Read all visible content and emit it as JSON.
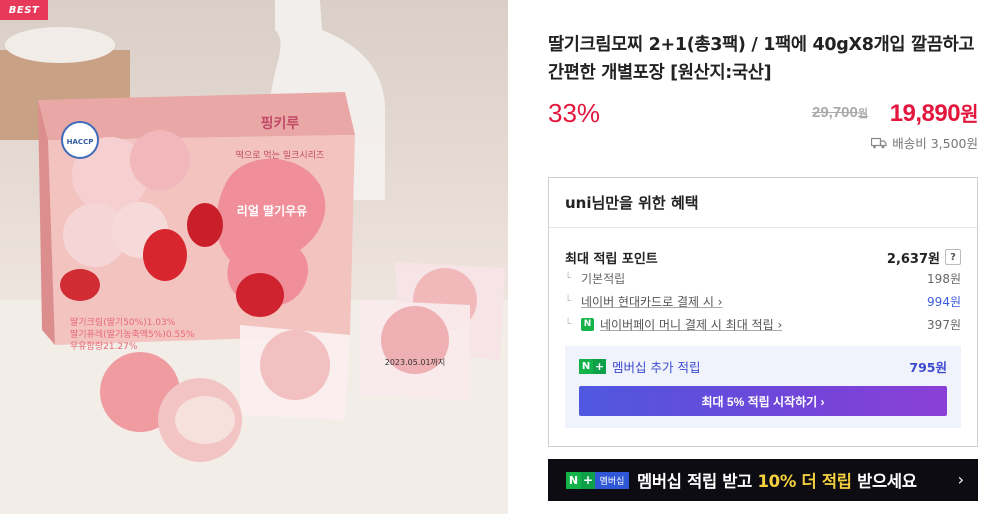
{
  "image": {
    "badge": "BEST",
    "box_brand": "핑키루",
    "box_tagline": "떡으로 먹는 밀크시리즈",
    "box_product": "리얼 딸기우유",
    "haccp": "HACCP",
    "ingredients": [
      "딸기크림(딸기50%)1.03%",
      "딸기퓨레(딸기농축액5%)0.55%",
      "우유함량21.27%"
    ],
    "pack_date": "2023.05.01까지"
  },
  "product": {
    "title": "딸기크림모찌 2+1(총3팩) / 1팩에 40gX8개입 깔끔하고 간편한 개별포장 [원산지:국산]",
    "discount": "33%",
    "original_price": "29,700",
    "original_unit": "원",
    "sale_price": "19,890",
    "sale_unit": "원",
    "shipping": "배송비 3,500원"
  },
  "benefits": {
    "header": "uni님만을 위한 혜택",
    "max_point_label": "최대 적립 포인트",
    "max_point_value": "2,637원",
    "help": "?",
    "rows": [
      {
        "label": "기본적립",
        "value": "198원"
      },
      {
        "label": "네이버 현대카드로 결제 시 ›",
        "value": "994원"
      },
      {
        "label": "네이버페이 머니 결제 시 최대 적립 ›",
        "value": "397원"
      }
    ],
    "membership_label": "멤버십 추가 적립",
    "membership_value": "795원",
    "start_button": "최대 5% 적립 시작하기 ›"
  },
  "banner": {
    "badge_m": "멤버십",
    "text_a": "멤버십 적립 받고 ",
    "text_hl": "10% 더 적립",
    "text_b": " 받으세요",
    "chevron": "›"
  },
  "colors": {
    "accent_red": "#e3173e",
    "naver_green": "#13b34a",
    "membership_blue": "#3d4ad0",
    "banner_bg": "#0c0c12",
    "highlight_yellow": "#f4d03f"
  }
}
